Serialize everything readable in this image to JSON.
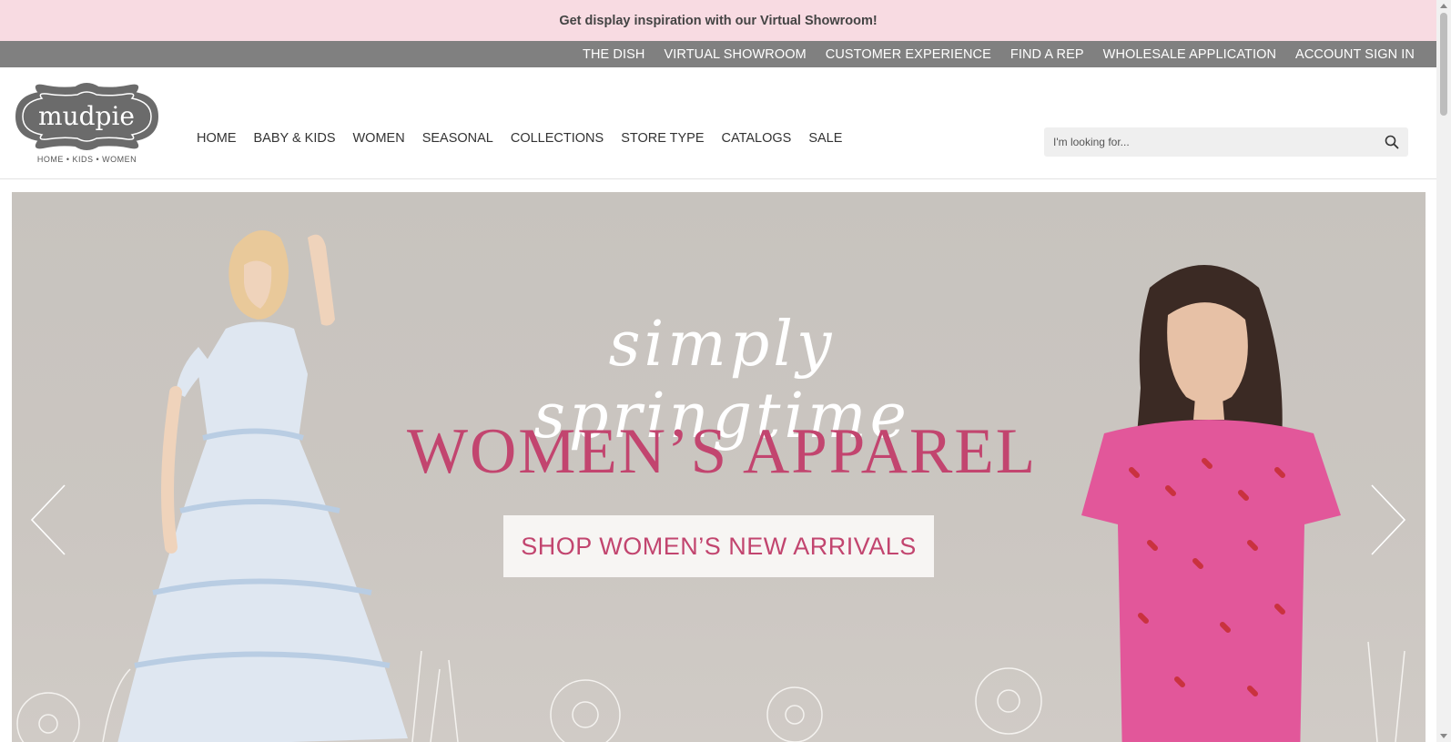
{
  "promo": {
    "text": "Get display inspiration with our Virtual Showroom!"
  },
  "utility_nav": {
    "items": [
      {
        "label": "THE DISH"
      },
      {
        "label": "VIRTUAL SHOWROOM"
      },
      {
        "label": "CUSTOMER EXPERIENCE"
      },
      {
        "label": "FIND A REP"
      },
      {
        "label": "WHOLESALE APPLICATION"
      },
      {
        "label": "ACCOUNT SIGN IN"
      }
    ]
  },
  "logo": {
    "text": "mudpie",
    "tagline": "HOME • KIDS • WOMEN"
  },
  "main_nav": {
    "items": [
      {
        "label": "HOME"
      },
      {
        "label": "BABY & KIDS"
      },
      {
        "label": "WOMEN"
      },
      {
        "label": "SEASONAL"
      },
      {
        "label": "COLLECTIONS"
      },
      {
        "label": "STORE TYPE"
      },
      {
        "label": "CATALOGS"
      },
      {
        "label": "SALE"
      }
    ]
  },
  "search": {
    "placeholder": "I'm looking for...",
    "value": ""
  },
  "hero": {
    "script_title": "simply springtime",
    "headline": "WOMEN’S APPAREL",
    "cta_label": "SHOP WOMEN’S NEW ARRIVALS"
  },
  "colors": {
    "promo_bg": "#f8dbe2",
    "utility_bg": "#808080",
    "accent_pink": "#c2456f",
    "hero_bg": "#c9c4bf"
  },
  "icons": {
    "search": "search-icon",
    "prev": "chevron-left-icon",
    "next": "chevron-right-icon"
  }
}
